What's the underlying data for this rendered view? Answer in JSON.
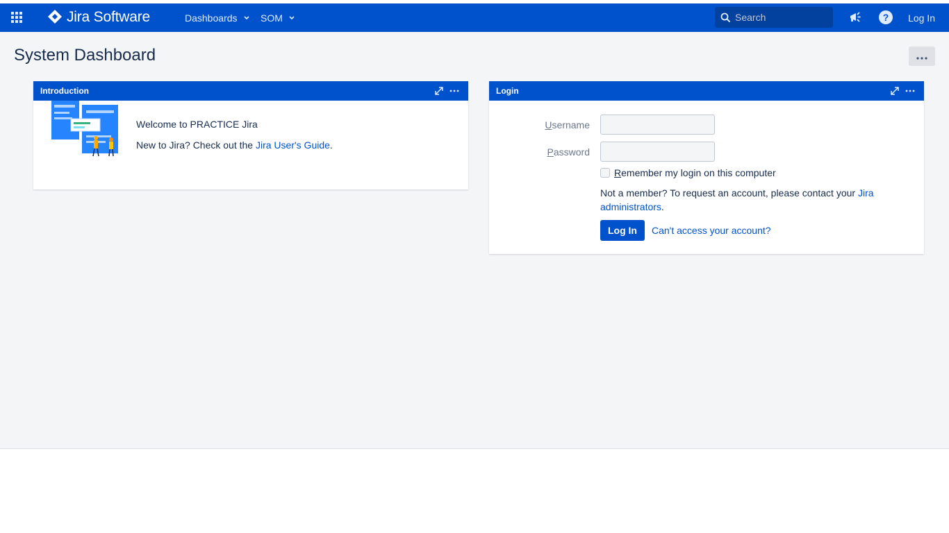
{
  "header": {
    "app_switcher_icon": "app-switcher-grid-icon",
    "logo_text": "Jira Software",
    "nav": [
      {
        "label": "Dashboards"
      },
      {
        "label": "SOM"
      }
    ],
    "search_placeholder": "Search",
    "announce_icon": "megaphone-icon",
    "help_icon": "help-icon",
    "login_label": "Log In",
    "color": "#0052cc"
  },
  "page": {
    "title": "System Dashboard",
    "tools_icon": "more-icon"
  },
  "gadgets": {
    "introduction": {
      "title": "Introduction",
      "welcome": "Welcome to PRACTICE Jira",
      "new_text": "New to Jira? Check out the",
      "guide_link": "Jira User's Guide",
      "period": "."
    },
    "login": {
      "title": "Login",
      "username_label_first": "U",
      "username_label_rest": "sername",
      "password_label_first": "P",
      "password_label_rest": "assword",
      "remember_first": "R",
      "remember_rest": "emember my login on this computer",
      "member_text": "Not a member? To request an account, please contact your",
      "admins_link": "Jira administrators",
      "period": ".",
      "login_button": "Log In",
      "cant_access": "Can't access your account?"
    }
  }
}
